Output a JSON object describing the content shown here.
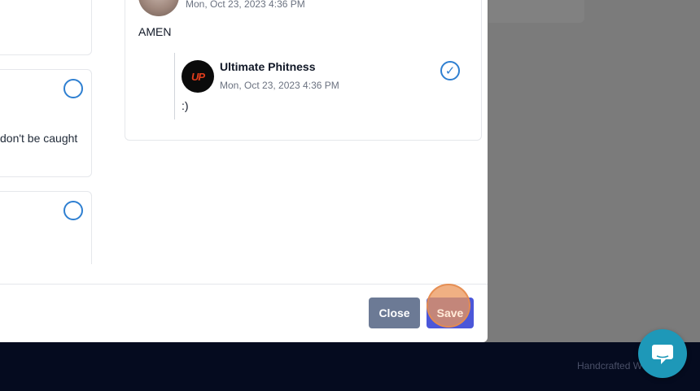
{
  "background": {
    "footer_text": "Handcrafted W"
  },
  "left_cards": [
    {
      "text": ""
    },
    {
      "text": "don't be caught"
    },
    {
      "text": ""
    }
  ],
  "thread": {
    "top_comment": {
      "date": "Mon, Oct 23, 2023 4:36 PM",
      "message": "AMEN"
    },
    "reply": {
      "author": "Ultimate Phitness",
      "avatar_text": "UP",
      "date": "Mon, Oct 23, 2023 4:36 PM",
      "message": ":)",
      "checked": true
    }
  },
  "footer": {
    "close_label": "Close",
    "save_label": "Save"
  },
  "colors": {
    "accent": "#2e7fd1",
    "save_button": "#4b57d9",
    "close_button": "#6c7a95",
    "chat_widget": "#1e98b8"
  },
  "icons": {
    "check": "check-circle-icon",
    "chat": "chat-bubble-icon"
  }
}
